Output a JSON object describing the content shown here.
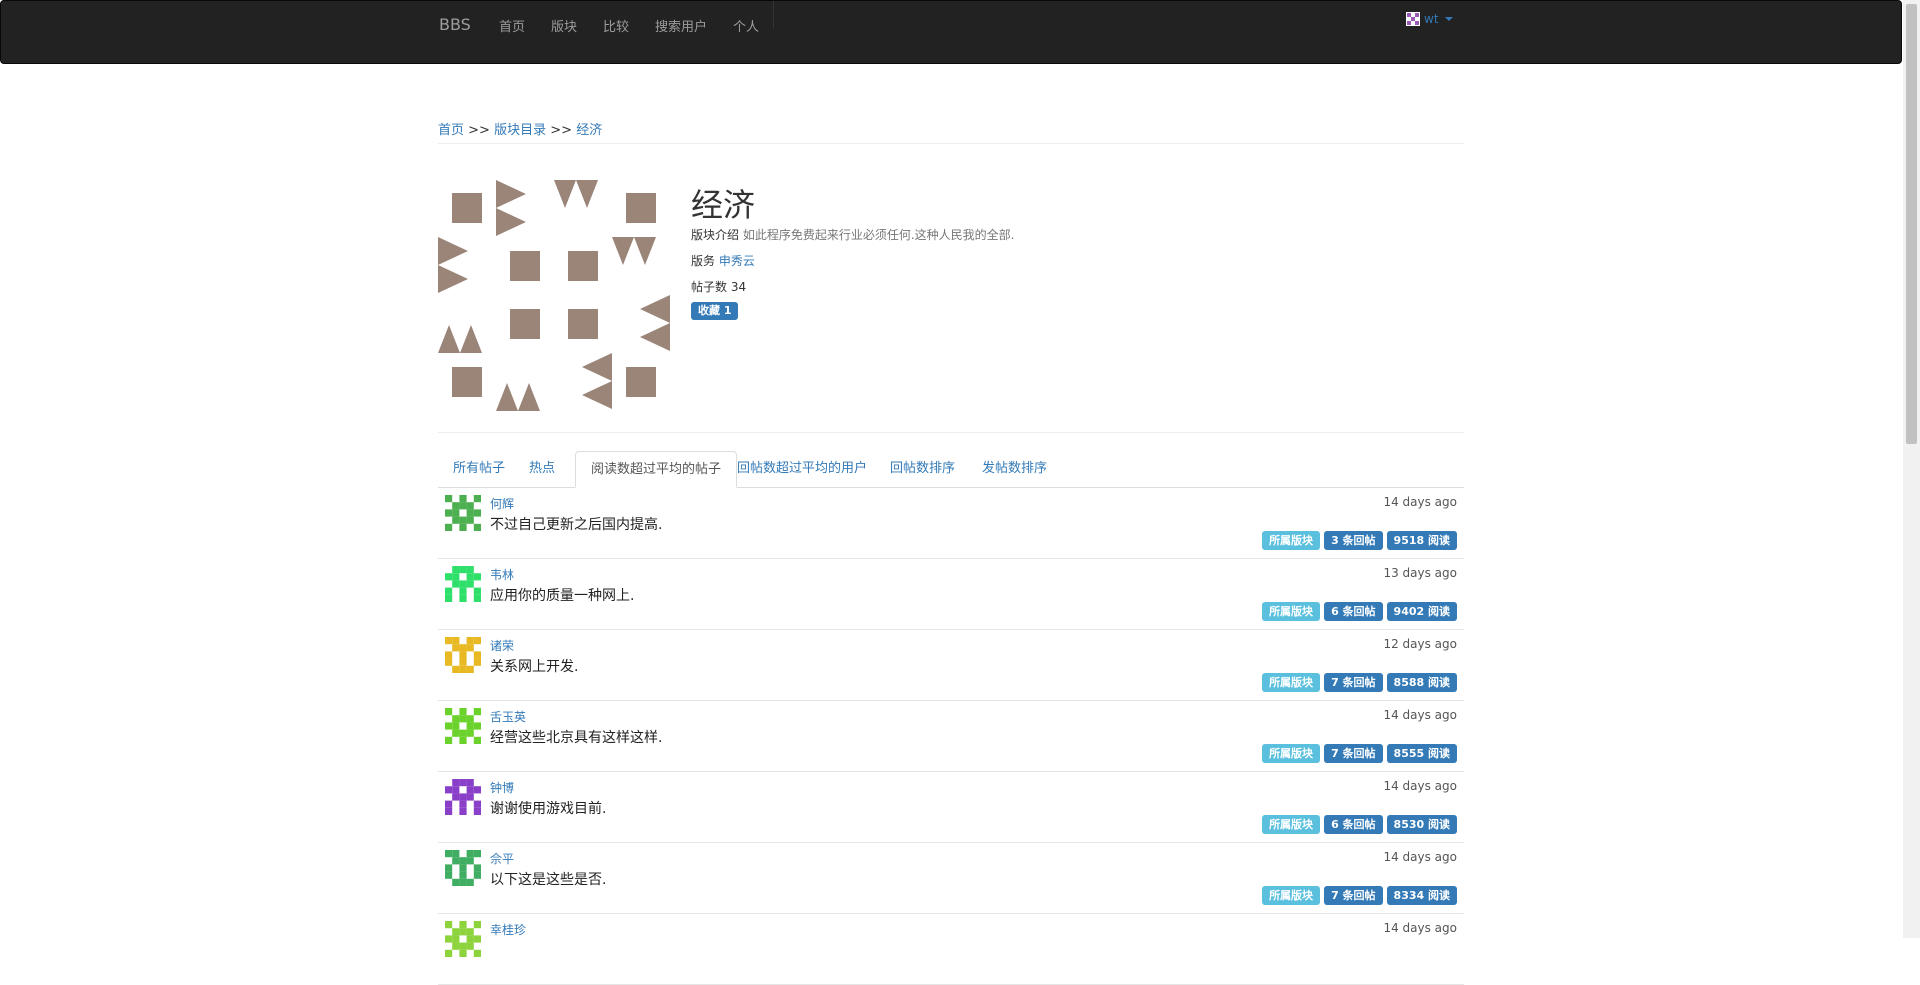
{
  "nav": {
    "brand": "BBS",
    "items": [
      "首页",
      "版块",
      "比较",
      "搜索用户",
      "个人"
    ],
    "user": "wt"
  },
  "breadcrumb": {
    "home": "首页",
    "sep1": ">>",
    "catalog": "版块目录",
    "sep2": ">>",
    "current": "经济"
  },
  "board": {
    "title": "经济",
    "intro_label": "版块介绍",
    "intro_text": "如此程序免费起来行业必须任何.这种人民我的全部.",
    "moderator_label": "版务",
    "moderator": "申秀云",
    "posts_label": "帖子数",
    "posts_count": "34",
    "favorite": "收藏 1",
    "icon_color": "#9b8579"
  },
  "tabs": [
    "所有帖子",
    "热点",
    "阅读数超过平均的帖子",
    "回帖数超过平均的用户",
    "回帖数排序",
    "发帖数排序"
  ],
  "active_tab": 2,
  "posts": [
    {
      "author": "何辉",
      "title": "不过自己更新之后国内提高.",
      "time": "14 days ago",
      "board": "所属版块",
      "replies": "3 条回帖",
      "reads": "9518 阅读",
      "avatar_color": "#4caf50"
    },
    {
      "author": "韦林",
      "title": "应用你的质量一种网上.",
      "time": "13 days ago",
      "board": "所属版块",
      "replies": "6 条回帖",
      "reads": "9402 阅读",
      "avatar_color": "#2ee06a"
    },
    {
      "author": "诸荣",
      "title": "关系网上开发.",
      "time": "12 days ago",
      "board": "所属版块",
      "replies": "7 条回帖",
      "reads": "8588 阅读",
      "avatar_color": "#e8b923"
    },
    {
      "author": "舌玉英",
      "title": "经营这些北京具有这样这样.",
      "time": "14 days ago",
      "board": "所属版块",
      "replies": "7 条回帖",
      "reads": "8555 阅读",
      "avatar_color": "#6ad22a"
    },
    {
      "author": "钟博",
      "title": "谢谢使用游戏目前.",
      "time": "14 days ago",
      "board": "所属版块",
      "replies": "6 条回帖",
      "reads": "8530 阅读",
      "avatar_color": "#8a3fc9"
    },
    {
      "author": "佘平",
      "title": "以下这是这些是否.",
      "time": "14 days ago",
      "board": "所属版块",
      "replies": "7 条回帖",
      "reads": "8334 阅读",
      "avatar_color": "#3fae62"
    },
    {
      "author": "幸桂珍",
      "title": "",
      "time": "14 days ago",
      "board": "",
      "replies": "",
      "reads": "",
      "avatar_color": "#8cd33c"
    }
  ]
}
